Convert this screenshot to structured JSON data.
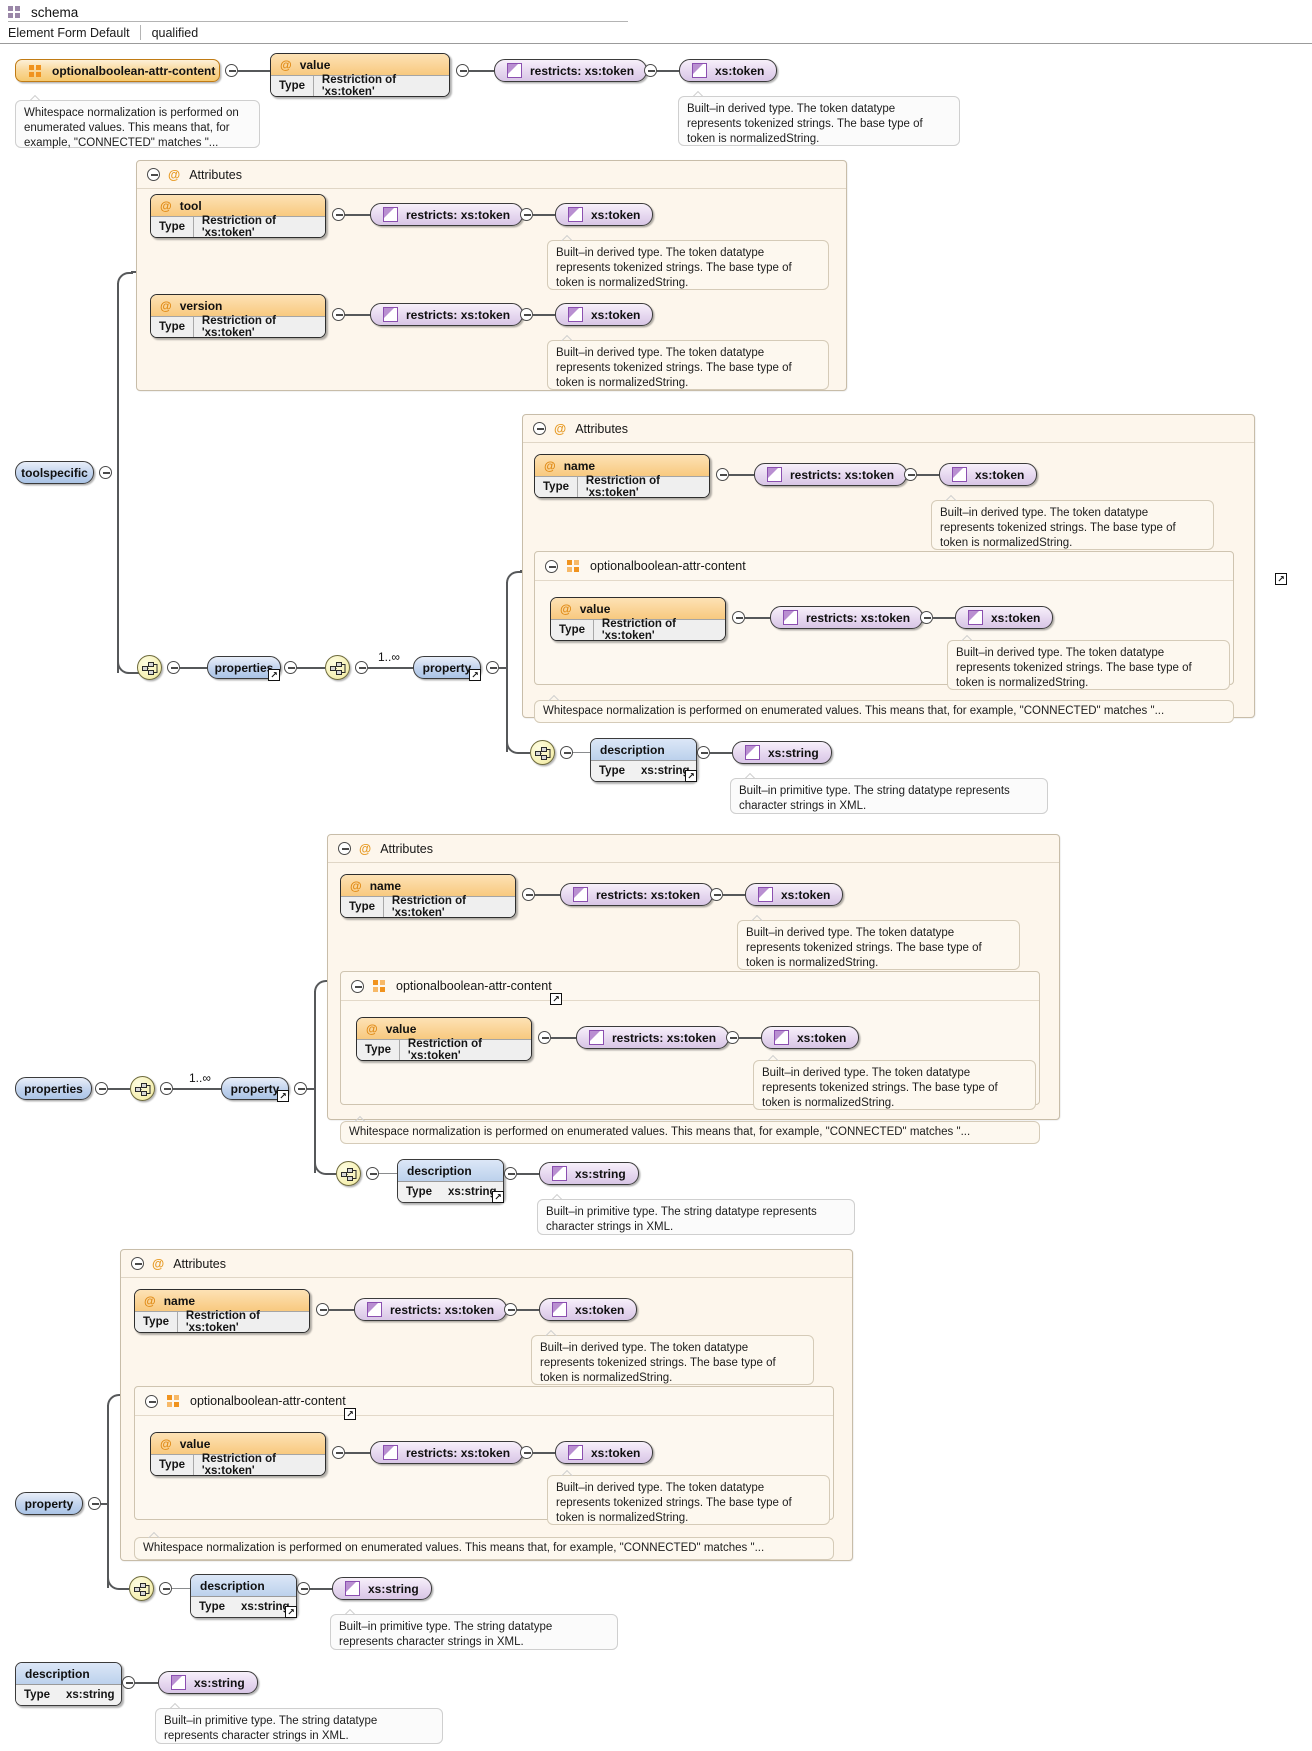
{
  "header": {
    "icon": "schema-icon",
    "title": "schema",
    "property_label": "Element Form Default",
    "property_value": "qualified"
  },
  "labels": {
    "attributes_group": "Attributes",
    "at_sign": "@",
    "minus_toggle": "minus-toggle-icon",
    "link_badge": "↗",
    "occurs_unbounded": "1..∞"
  },
  "docs": {
    "whitespace_short": "Whitespace normalization is performed on enumerated values. This means that, for example, \"CONNECTED\" matches \"...",
    "whitespace_wrapped": "Whitespace normalization is performed on enumerated values. This means that, for example, \"CONNECTED\" matches \"...",
    "token_derived": "Built–in derived type. The token datatype represents tokenized strings. The base type of token is normalizedString.",
    "string_primitive": "Built–in primitive type. The string datatype represents character strings in XML."
  },
  "types": {
    "token": "xs:token",
    "string": "xs:string",
    "restricts_token": "restricts: xs:token",
    "restriction_of_token": "Restriction of 'xs:token'",
    "type_key": "Type"
  },
  "nodes": {
    "optionalboolean_attr_content": "optionalboolean-attr-content",
    "toolspecific": "toolspecific",
    "properties": "properties",
    "property": "property",
    "description": "description",
    "attr_value": "value",
    "attr_tool": "tool",
    "attr_version": "version",
    "attr_name": "name"
  },
  "colors": {
    "element_fill": "#c3d4ee",
    "attribute_fill": "#f8c97f",
    "type_fill": "#e6d7ef",
    "group_fill": "#f6c96f",
    "sequence_fill": "#f7f2b8",
    "box_fill": "#fdf6ec",
    "line": "#56585a"
  }
}
